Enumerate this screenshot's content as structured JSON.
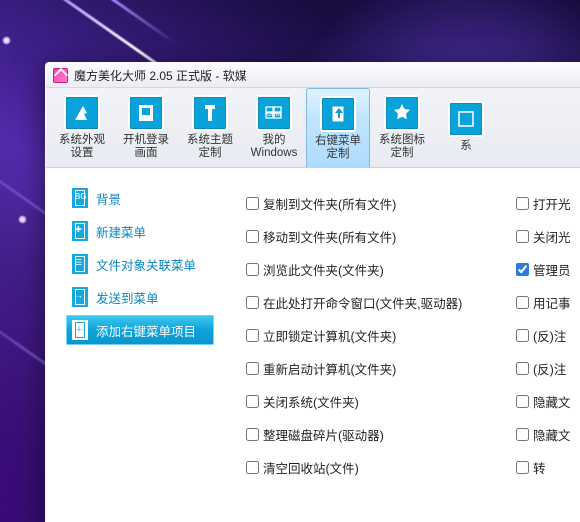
{
  "window": {
    "title": "魔方美化大师 2.05 正式版 - 软媒"
  },
  "tabs": [
    {
      "id": "appearance",
      "label": "系统外观\n设置"
    },
    {
      "id": "boot",
      "label": "开机登录\n画面"
    },
    {
      "id": "theme",
      "label": "系统主题\n定制"
    },
    {
      "id": "mywin",
      "label": "我的\nWindows"
    },
    {
      "id": "context",
      "label": "右键菜单\n定制",
      "active": true
    },
    {
      "id": "sysicon",
      "label": "系统图标\n定制"
    },
    {
      "id": "more",
      "label": "系\n"
    }
  ],
  "sidebar": [
    {
      "id": "bg",
      "label": "背景",
      "glyph": "BG"
    },
    {
      "id": "newmenu",
      "label": "新建菜单",
      "glyph": "✚"
    },
    {
      "id": "assoc",
      "label": "文件对象关联菜单",
      "glyph": "☰"
    },
    {
      "id": "sendto",
      "label": "发送到菜单",
      "glyph": "→"
    },
    {
      "id": "addctx",
      "label": "添加右键菜单项目",
      "glyph": "＋",
      "active": true
    }
  ],
  "checks": {
    "col1": [
      {
        "label": "复制到文件夹(所有文件)",
        "checked": false
      },
      {
        "label": "移动到文件夹(所有文件)",
        "checked": false
      },
      {
        "label": "浏览此文件夹(文件夹)",
        "checked": false
      },
      {
        "label": "在此处打开命令窗口(文件夹,驱动器)",
        "checked": false
      },
      {
        "label": "立即锁定计算机(文件夹)",
        "checked": false
      },
      {
        "label": "重新启动计算机(文件夹)",
        "checked": false
      },
      {
        "label": "关闭系统(文件夹)",
        "checked": false
      },
      {
        "label": "整理磁盘碎片(驱动器)",
        "checked": false
      },
      {
        "label": "清空回收站(文件)",
        "checked": false
      }
    ],
    "col2": [
      {
        "label": "打开光",
        "checked": false
      },
      {
        "label": "关闭光",
        "checked": false
      },
      {
        "label": "管理员",
        "checked": true
      },
      {
        "label": "用记事",
        "checked": false
      },
      {
        "label": "(反)注",
        "checked": false
      },
      {
        "label": "(反)注",
        "checked": false
      },
      {
        "label": "隐藏文",
        "checked": false
      },
      {
        "label": "隐藏文",
        "checked": false
      },
      {
        "label": "转",
        "checked": false
      }
    ]
  }
}
